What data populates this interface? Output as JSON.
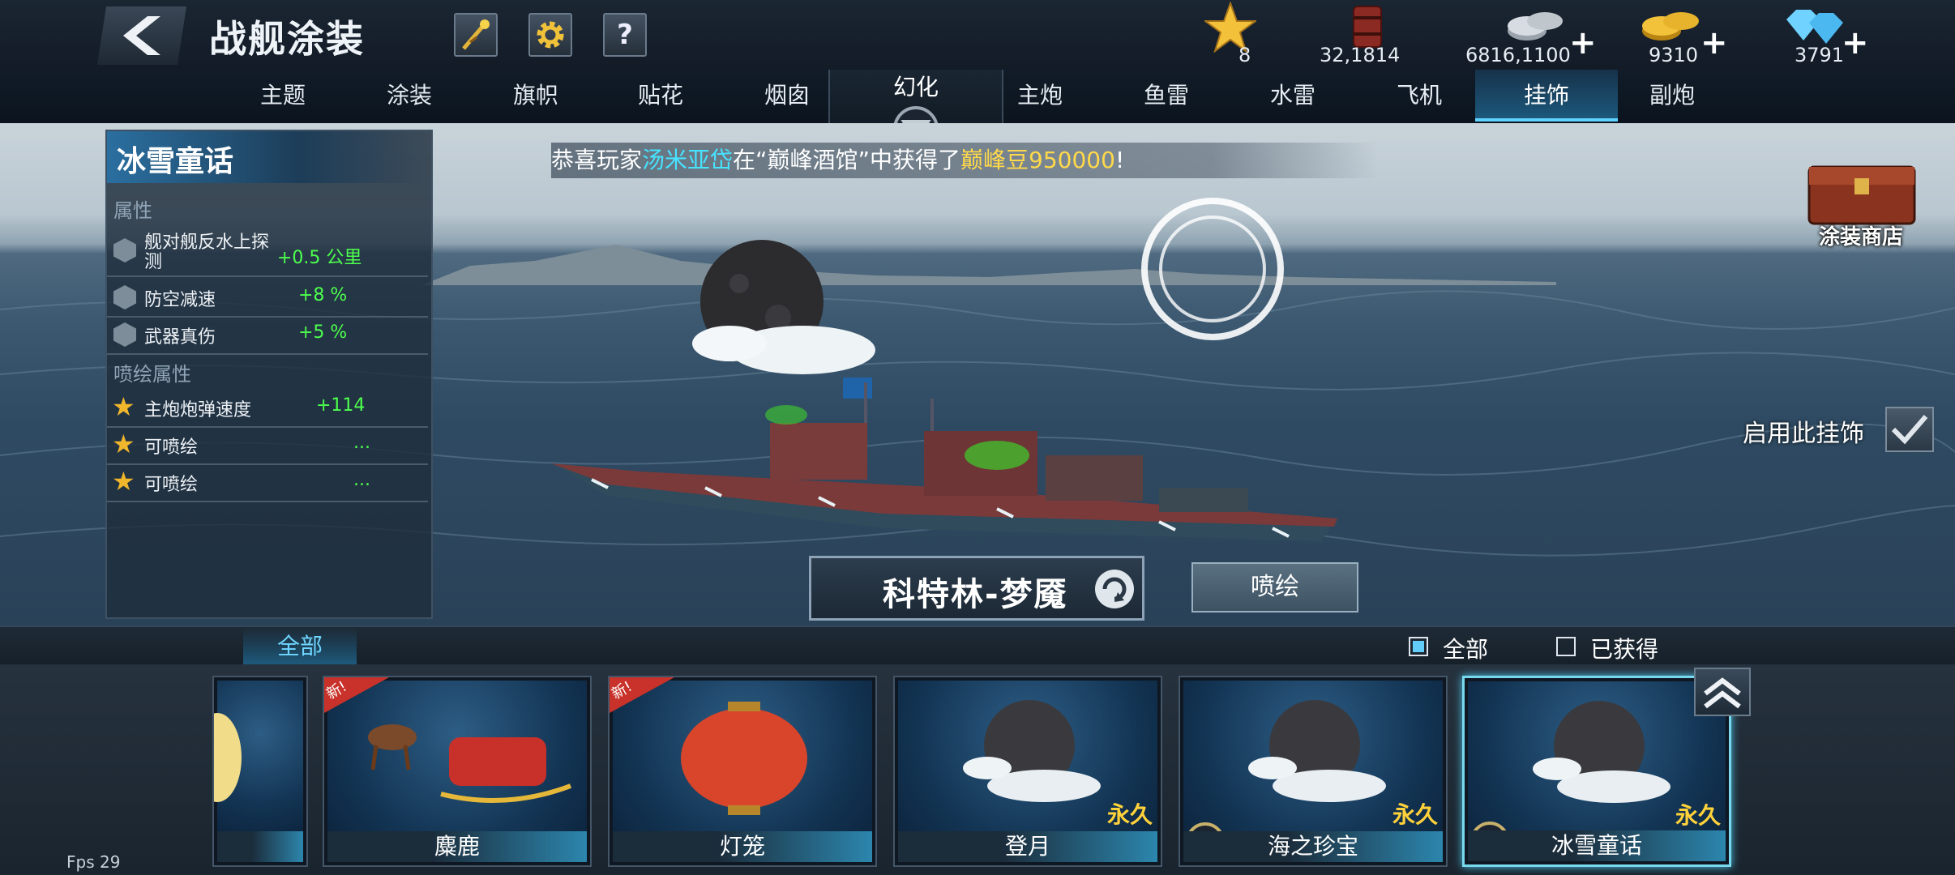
{
  "header": {
    "title": "战舰涂装",
    "resources": [
      {
        "name": "star",
        "icon": "star-icon",
        "value": "8"
      },
      {
        "name": "oil",
        "icon": "oil-barrel-icon",
        "value": "32,1814"
      },
      {
        "name": "silver",
        "icon": "silver-coins-icon",
        "value": "6816,1100"
      },
      {
        "name": "gold",
        "icon": "gold-coins-icon",
        "value": "9310"
      },
      {
        "name": "diamond",
        "icon": "diamond-icon",
        "value": "3791"
      }
    ],
    "help_label": "?"
  },
  "tabs": [
    {
      "label": "主题"
    },
    {
      "label": "涂装"
    },
    {
      "label": "旗帜"
    },
    {
      "label": "贴花"
    },
    {
      "label": "烟囱"
    },
    {
      "label": "幻化"
    },
    {
      "label": "主炮"
    },
    {
      "label": "鱼雷"
    },
    {
      "label": "水雷"
    },
    {
      "label": "飞机"
    },
    {
      "label": "挂饰",
      "active": true
    },
    {
      "label": "副炮"
    }
  ],
  "stats": {
    "title": "冰雪童话",
    "attributes_label": "属性",
    "attributes": [
      {
        "name_line1": "舰对舰反水上探",
        "name_line2": "测",
        "value": "+0.5 公里"
      },
      {
        "name": "防空减速",
        "value": "+8 %"
      },
      {
        "name": "武器真伤",
        "value": "+5 %"
      }
    ],
    "paint_attributes_label": "喷绘属性",
    "paint_attributes": [
      {
        "name": "主炮炮弹速度",
        "value": "+114"
      },
      {
        "name": "可喷绘",
        "value": "..."
      },
      {
        "name": "可喷绘",
        "value": "..."
      }
    ]
  },
  "announcement": {
    "prefix": "恭喜玩家",
    "player": "汤米亚岱",
    "middle": "在“巅峰酒馆”中获得了",
    "reward": "巅峰豆950000",
    "suffix": "!"
  },
  "ship_name": "科特林-梦魇",
  "paint_button": "喷绘",
  "enable_label": "启用此挂饰",
  "shop_label": "涂装商店",
  "filter": {
    "tab_all": "全部",
    "option_all": "全部",
    "option_owned": "已获得"
  },
  "items": [
    {
      "label": "",
      "new": false,
      "permanent": ""
    },
    {
      "label": "麋鹿",
      "new": true,
      "permanent": ""
    },
    {
      "label": "灯笼",
      "new": true,
      "permanent": ""
    },
    {
      "label": "登月",
      "new": false,
      "permanent": "永久"
    },
    {
      "label": "海之珍宝",
      "new": false,
      "permanent": "永久"
    },
    {
      "label": "冰雪童话",
      "new": false,
      "permanent": "永久",
      "selected": true
    }
  ],
  "new_badge": "新!",
  "fps": "Fps 29",
  "colors": {
    "accent": "#5fd3ff",
    "positive": "#4dff4d",
    "gold": "#ffd23a",
    "player": "#47e3ff"
  }
}
